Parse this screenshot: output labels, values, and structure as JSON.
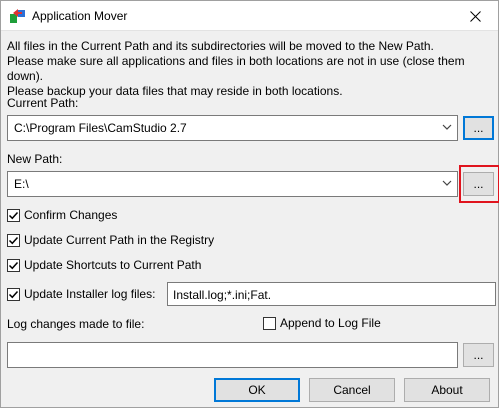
{
  "window": {
    "title": "Application Mover"
  },
  "info": {
    "line1": "All files in the Current Path and its subdirectories will be moved to the New Path.",
    "line2": "Please make sure all applications and files in both locations are not in use (close them down).",
    "line3": "Please backup your data files that may reside in both locations."
  },
  "current_path": {
    "label": "Current Path:",
    "value": "C:\\Program Files\\CamStudio 2.7",
    "browse_label": "..."
  },
  "new_path": {
    "label": "New Path:",
    "value": "E:\\",
    "browse_label": "..."
  },
  "options": {
    "confirm_changes": {
      "label": "Confirm Changes",
      "checked": true
    },
    "update_registry": {
      "label": "Update Current Path in the Registry",
      "checked": true
    },
    "update_shortcuts": {
      "label": "Update Shortcuts to Current Path",
      "checked": true
    },
    "update_installer_logs": {
      "label": "Update Installer log files:",
      "checked": true,
      "value": "Install.log;*.ini;Fat."
    }
  },
  "log": {
    "label": "Log changes made to file:",
    "append_label": "Append to Log File",
    "append_checked": false,
    "value": "",
    "browse_label": "..."
  },
  "buttons": {
    "ok": "OK",
    "cancel": "Cancel",
    "about": "About"
  },
  "colors": {
    "highlight": "#e0141e",
    "focus": "#0078d7"
  }
}
